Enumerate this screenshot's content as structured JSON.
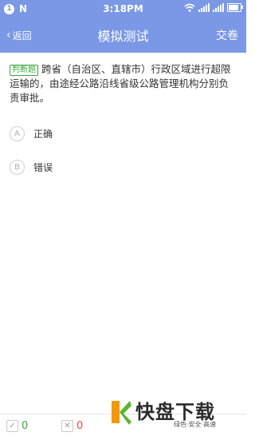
{
  "status_bar": {
    "notification_badge": "1",
    "app_icon_letter": "N",
    "time": "3:18PM"
  },
  "nav": {
    "back_label": "返回",
    "title": "模拟测试",
    "submit_label": "交卷"
  },
  "question": {
    "type_tag": "判断题",
    "text": "跨省（自治区、直辖市）行政区域进行超限运输的，由途经公路沿线省级公路管理机构分别负责审批。"
  },
  "options": [
    {
      "letter": "A",
      "label": "正确"
    },
    {
      "letter": "B",
      "label": "错误"
    }
  ],
  "stats": {
    "correct_count": "0",
    "wrong_count": "0"
  },
  "watermark": {
    "brand": "快盘下载",
    "slogan": "绿色·安全·高速"
  },
  "colors": {
    "header": "#7a98e6",
    "correct": "#3aa63a",
    "wrong": "#e84848"
  }
}
